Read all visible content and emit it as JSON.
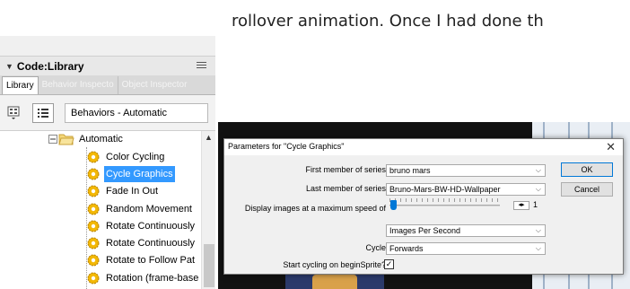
{
  "article": {
    "text": "rollover animation. Once I had done th"
  },
  "panel": {
    "title": "Code:Library",
    "tabs": [
      {
        "label": "Library"
      },
      {
        "label": "Behavior Inspecto"
      },
      {
        "label": "Object Inspector"
      }
    ],
    "behavior_select": "Behaviors - Automatic",
    "tree": {
      "folder": "Automatic",
      "items": [
        {
          "label": "Color Cycling",
          "selected": false
        },
        {
          "label": "Cycle Graphics",
          "selected": true
        },
        {
          "label": "Fade In Out",
          "selected": false
        },
        {
          "label": "Random Movement",
          "selected": false
        },
        {
          "label": "Rotate Continuously",
          "selected": false
        },
        {
          "label": "Rotate Continuously",
          "selected": false
        },
        {
          "label": "Rotate to Follow Pat",
          "selected": false
        },
        {
          "label": "Rotation (frame-base",
          "selected": false
        }
      ]
    }
  },
  "dialog": {
    "title": "Parameters for \"Cycle Graphics\"",
    "first_member_label": "First member of series",
    "first_member_value": "bruno mars",
    "last_member_label": "Last member of series",
    "last_member_value": "Bruno-Mars-BW-HD-Wallpaper",
    "speed_label": "Display images at a maximum speed of",
    "speed_value": "1",
    "speed_level": 0.0,
    "unit_value": "Images Per Second",
    "cycle_label": "Cycle",
    "cycle_value": "Forwards",
    "start_label": "Start cycling on beginSprite?",
    "start_checked": true,
    "ok_label": "OK",
    "cancel_label": "Cancel"
  },
  "colors": {
    "selection": "#3399ff",
    "accent": "#0078d7",
    "gear": "#f2b705"
  }
}
